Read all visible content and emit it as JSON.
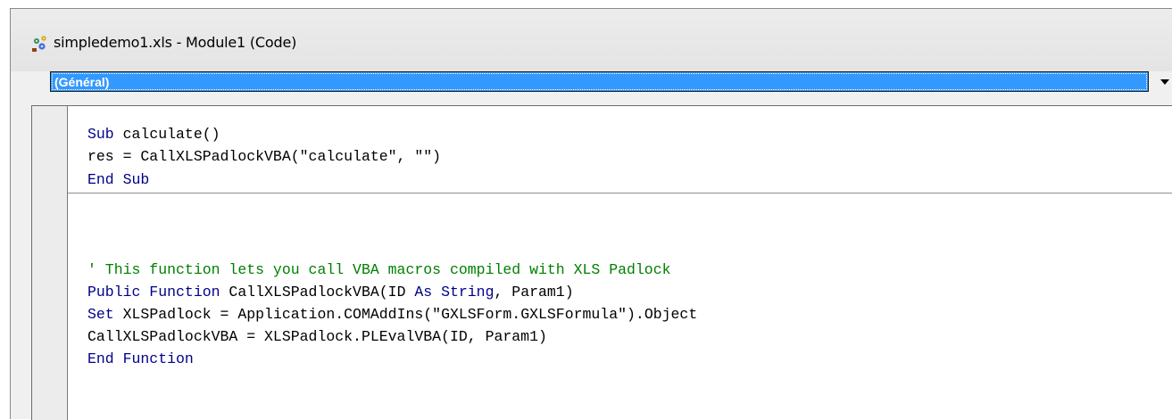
{
  "window": {
    "title": "simpledemo1.xls - Module1 (Code)",
    "icon": "vba-module-icon"
  },
  "object_combo": {
    "selected": "(Général)"
  },
  "code": {
    "proc1": [
      {
        "kw": "Sub",
        "rest": " calculate()"
      },
      {
        "text": "res = CallXLSPadlockVBA(\"calculate\", \"\")"
      },
      {
        "kw": "End Sub"
      }
    ],
    "comment": "' This function lets you call VBA macros compiled with XLS Padlock",
    "l5_kw1": "Public Function",
    "l5_mid": " CallXLSPadlockVBA(ID ",
    "l5_kw2": "As String",
    "l5_end": ", Param1)",
    "l6_kw": "Set",
    "l6_rest": " XLSPadlock = Application.COMAddIns(\"GXLSForm.GXLSFormula\").Object",
    "l7": "CallXLSPadlockVBA = XLSPadlock.PLEvalVBA(ID, Param1)",
    "l8_kw": "End Function"
  },
  "colors": {
    "keyword": "#00008b",
    "comment": "#008000",
    "selection": "#3399ff"
  }
}
